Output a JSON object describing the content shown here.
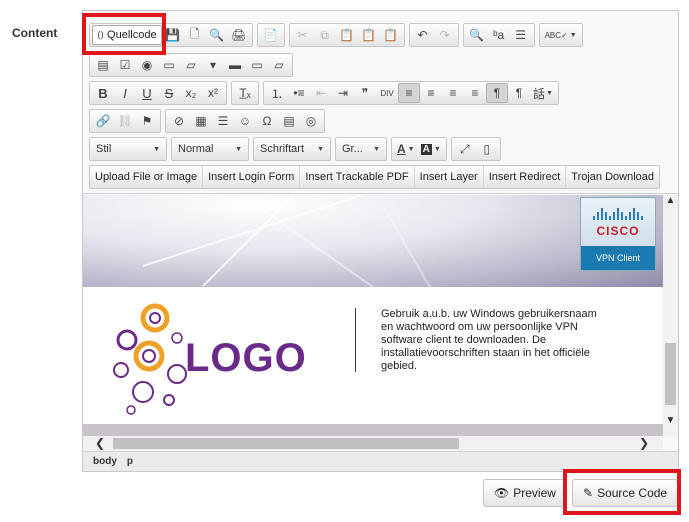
{
  "field_label": "Content",
  "toolbar": {
    "source_button": "Quellcode",
    "row1_icons": [
      "💾",
      "🗋",
      "🔍",
      "🖨",
      "📄"
    ],
    "row1_icons_clip": [
      "✂",
      "⧉",
      "📋",
      "📋",
      "📋"
    ],
    "row1_undo": [
      "↶",
      "↷"
    ],
    "row1_find": [
      "🔍",
      "ᵇa"
    ],
    "row1_misc": [
      "☰"
    ],
    "row1_spell": "ABC✓",
    "row2_icons": [
      "▤",
      "☑",
      "◉",
      "▭",
      "▱",
      "▾",
      "▬",
      "▭",
      "▱"
    ],
    "row3_basic": [
      "B",
      "I",
      "U",
      "S",
      "x₂",
      "x²",
      "T̲ₓ"
    ],
    "row3_list": [
      "⒈",
      "•≡",
      "⇤",
      "⇥",
      "❞",
      "DIV",
      "≡",
      "≡",
      "≡",
      "≡",
      "¶",
      "¶",
      "話"
    ],
    "row4_links": [
      "🔗",
      "⛓",
      "⚑"
    ],
    "row4_insert": [
      "⊘",
      "▦",
      "☰",
      "☺",
      "Ω",
      "▤",
      "◎"
    ],
    "combos": [
      {
        "label": "Stil"
      },
      {
        "label": "Normal"
      },
      {
        "label": "Schriftart"
      },
      {
        "label": "Gr..."
      }
    ],
    "color_buttons": [
      "A",
      "A"
    ],
    "view_buttons": [
      "⤢",
      "▯"
    ],
    "plugins": [
      "Upload File or Image",
      "Insert Login Form",
      "Insert Trackable PDF",
      "Insert Layer",
      "Insert Redirect",
      "Trojan Download"
    ]
  },
  "content": {
    "cisco_word": "CISCO",
    "cisco_sub": "VPN Client",
    "logo_text": "LOGO",
    "info_text": "Gebruik a.u.b. uw Windows gebruikersnaam en wachtwoord om uw persoonlijke VPN software client te downloaden. De installatievoorschriften staan in het officiële gebied."
  },
  "status_path": [
    "body",
    "p"
  ],
  "buttons": {
    "preview": "Preview",
    "source_code": "Source Code"
  },
  "colors": {
    "highlight": "#e0151d",
    "logo_purple": "#6b2a8a",
    "logo_orange": "#f0a12a",
    "cisco_red": "#cc1f25",
    "cisco_blue": "#1b7bb0"
  }
}
